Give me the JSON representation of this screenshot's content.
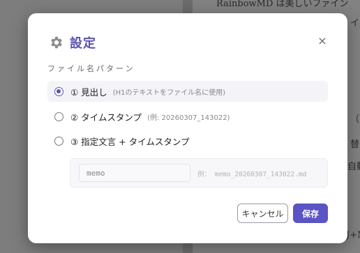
{
  "background_doc": {
    "lines": [
      "RainbowMD は美しいファイン",
      "イ",
      "（",
      "替",
      "自動",
      "J+N"
    ]
  },
  "dialog": {
    "title": "設定",
    "close_label": "×",
    "section_label": "ファイル名パターン",
    "options": [
      {
        "label": "① 見出し",
        "hint": "(H1のテキストをファイル名に使用)",
        "selected": true
      },
      {
        "label": "② タイムスタンプ",
        "hint": "(例: 20260307_143022)",
        "selected": false
      },
      {
        "label": "③ 指定文言 + タイムスタンプ",
        "hint": "",
        "selected": false
      }
    ],
    "memo_input": {
      "value": "memo",
      "placeholder": ""
    },
    "memo_example": "例： memo_20260307_143022.md",
    "cancel_label": "キャンセル",
    "save_label": "保存"
  },
  "colors": {
    "accent": "#5b54c4",
    "title": "#5b54b0"
  }
}
